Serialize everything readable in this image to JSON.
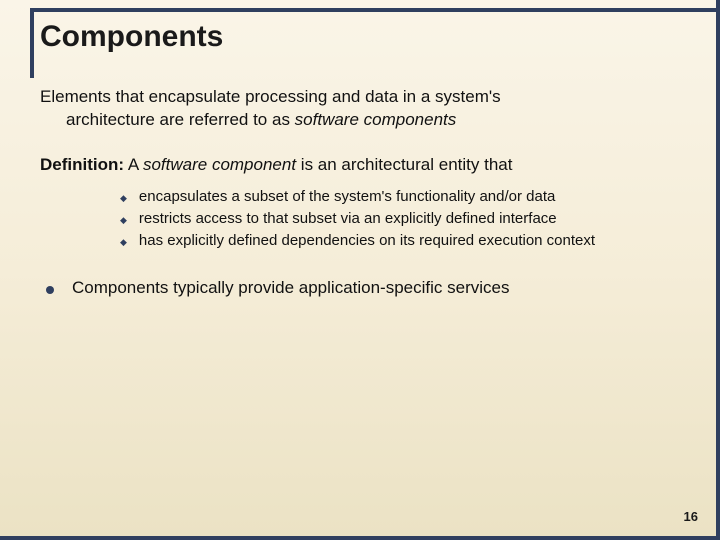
{
  "title": "Components",
  "intro": {
    "line1": "Elements that encapsulate processing and data in a system's",
    "line2_prefix": "architecture are referred to as ",
    "line2_em": "software components"
  },
  "definition": {
    "label": "Definition:",
    "pre": " A ",
    "em": "software component",
    "post": " is an architectural entity that"
  },
  "bullets": [
    "encapsulates a subset of the system's functionality and/or data",
    "restricts access to that subset via an explicitly defined interface",
    "has explicitly defined dependencies on its required execution context"
  ],
  "closing": "Components typically provide application-specific services",
  "page_number": "16"
}
